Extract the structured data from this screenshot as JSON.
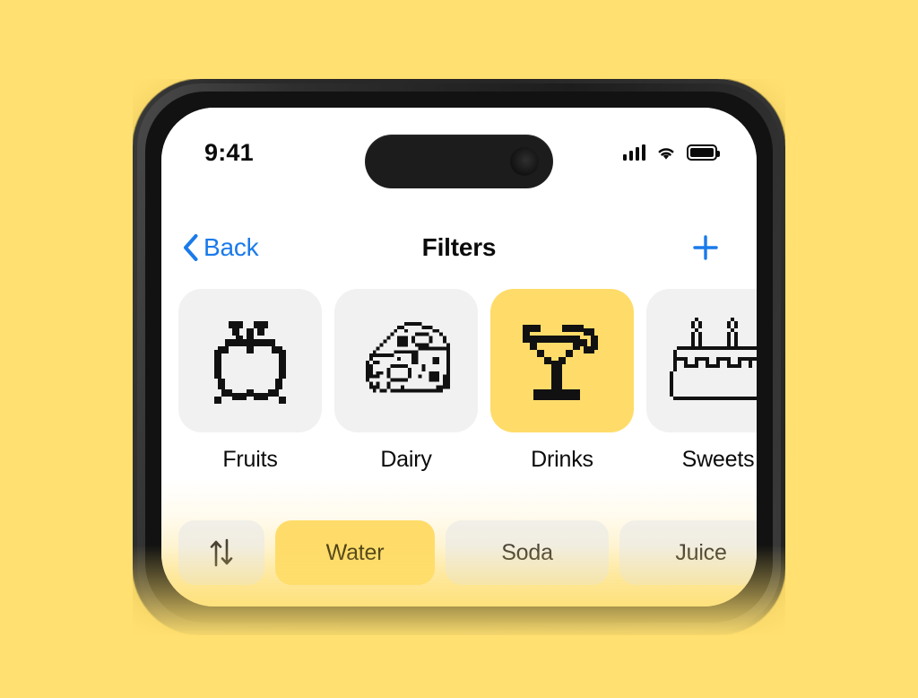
{
  "page": {
    "background_color": "#FFE070"
  },
  "device": {
    "frame_color": "#262626",
    "screen_background": "#FFFFFF",
    "buttons": [
      {
        "name": "silent-switch",
        "side": "left"
      },
      {
        "name": "volume-up-button",
        "side": "left"
      },
      {
        "name": "volume-down-button",
        "side": "left"
      },
      {
        "name": "power-button",
        "side": "right"
      }
    ]
  },
  "status_bar": {
    "time": "9:41",
    "cellular_icon": "signal-bars-icon",
    "cellular_bars": 4,
    "wifi_icon": "wifi-icon",
    "battery_icon": "battery-full-icon",
    "battery_level": 100
  },
  "nav_bar": {
    "back_label": "Back",
    "back_icon": "chevron-left-icon",
    "title": "Filters",
    "add_icon": "plus-icon",
    "accent_color": "#1A7AEA"
  },
  "categories": {
    "selected": "Drinks",
    "selected_color": "#FFDC69",
    "tile_color": "#F1F1F1",
    "items": [
      {
        "label": "Fruits",
        "icon": "apple-pixel-icon",
        "selected": false
      },
      {
        "label": "Dairy",
        "icon": "cheese-pixel-icon",
        "selected": false
      },
      {
        "label": "Drinks",
        "icon": "cocktail-pixel-icon",
        "selected": true
      },
      {
        "label": "Sweets",
        "icon": "cake-pixel-icon",
        "selected": false
      }
    ]
  },
  "filter_chips": {
    "selected": "Water",
    "selected_color": "#FFDC69",
    "sort_icon": "sort-arrows-icon",
    "items": [
      {
        "label": "Water",
        "selected": true
      },
      {
        "label": "Soda",
        "selected": false
      },
      {
        "label": "Juice",
        "selected": false
      }
    ]
  }
}
